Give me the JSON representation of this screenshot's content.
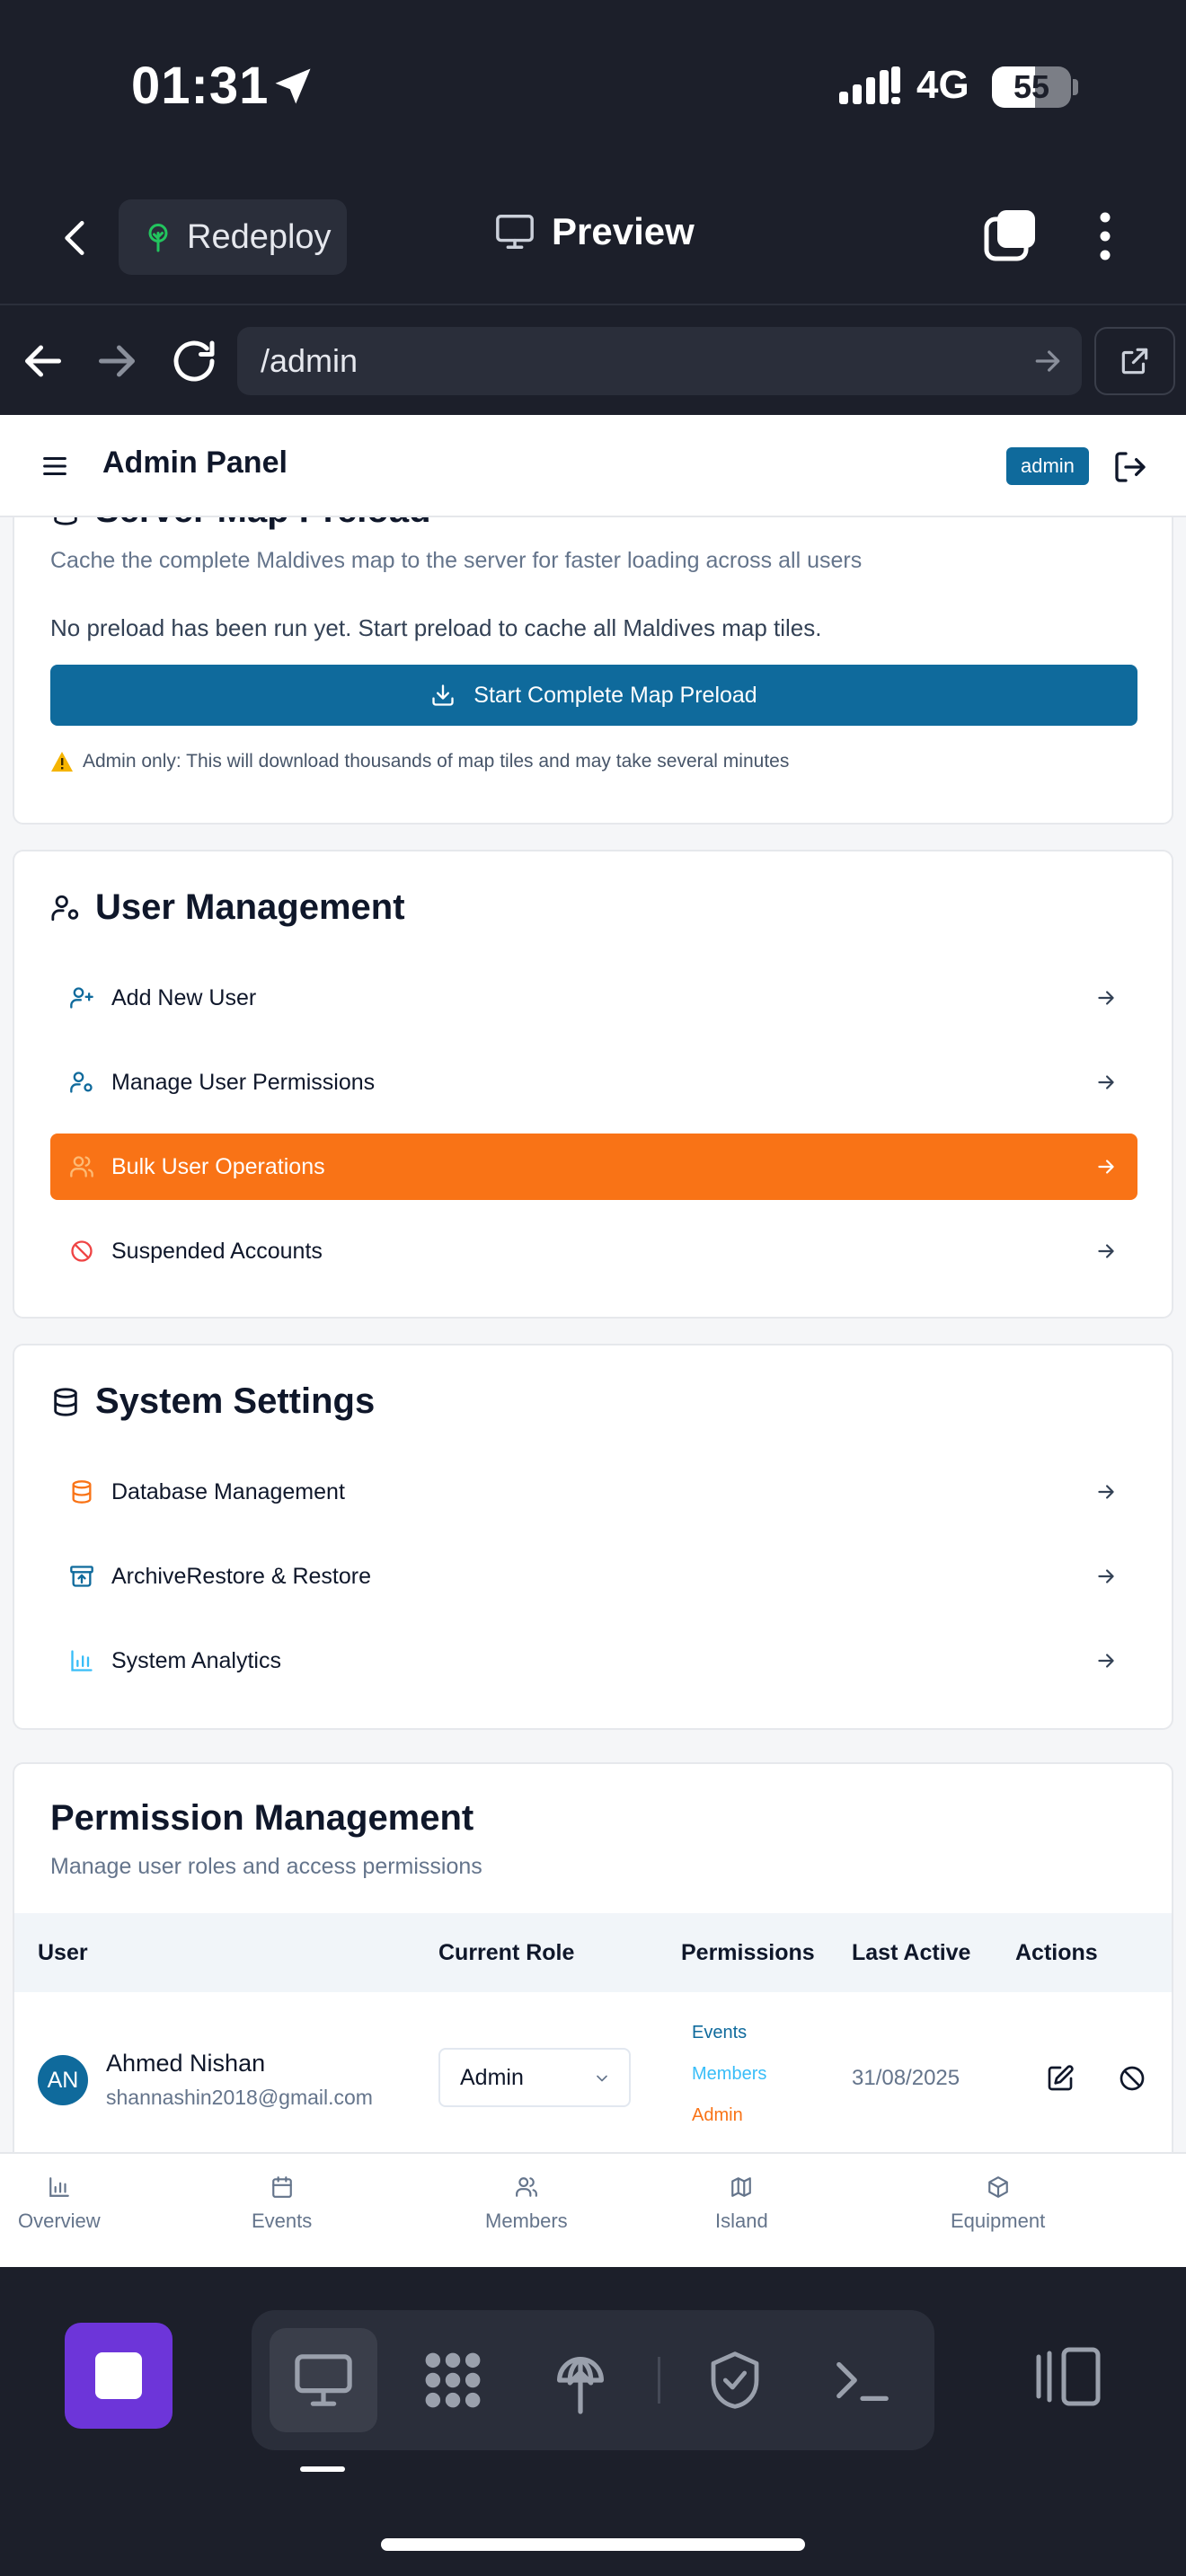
{
  "status_bar": {
    "time": "01:31",
    "network": "4G",
    "battery": "55",
    "battery_level": 0.55
  },
  "app_header": {
    "redeploy_label": "Redeploy",
    "preview_label": "Preview"
  },
  "browser": {
    "url": "/admin"
  },
  "topbar": {
    "title": "Admin Panel",
    "role_badge": "admin"
  },
  "preload_card": {
    "title": "Server Map Preload",
    "description": "Cache the complete Maldives map to the server for faster loading across all users",
    "status": "No preload has been run yet. Start preload to cache all Maldives map tiles.",
    "button_label": "Start Complete Map Preload",
    "warning": "Admin only: This will download thousands of map tiles and may take several minutes"
  },
  "user_management": {
    "title": "User Management",
    "items": [
      {
        "label": "Add New User",
        "icon": "user-plus-icon"
      },
      {
        "label": "Manage User Permissions",
        "icon": "user-cog-icon"
      },
      {
        "label": "Bulk User Operations",
        "icon": "users-icon",
        "active": true
      },
      {
        "label": "Suspended Accounts",
        "icon": "ban-icon"
      }
    ]
  },
  "system_settings": {
    "title": "System Settings",
    "items": [
      {
        "label": "Database Management",
        "icon": "database-icon"
      },
      {
        "label": "ArchiveRestore & Restore",
        "icon": "archive-restore-icon"
      },
      {
        "label": "System Analytics",
        "icon": "bar-chart-icon"
      }
    ]
  },
  "permission_management": {
    "title": "Permission Management",
    "subtitle": "Manage user roles and access permissions",
    "columns": [
      "User",
      "Current Role",
      "Permissions",
      "Last Active",
      "Actions"
    ],
    "rows": [
      {
        "initials": "AN",
        "name": "Ahmed Nishan",
        "email": "shannashin2018@gmail.com",
        "role": "Admin",
        "permissions": [
          "Events",
          "Members",
          "Admin"
        ],
        "last_active": "31/08/2025"
      }
    ]
  },
  "bottom_nav": [
    "Overview",
    "Events",
    "Members",
    "Island",
    "Equipment"
  ],
  "colors": {
    "primary": "#0f6a9c",
    "accent_orange": "#f97316",
    "dark_bg": "#1c1f2a",
    "dock_purple": "#6d35d9"
  }
}
